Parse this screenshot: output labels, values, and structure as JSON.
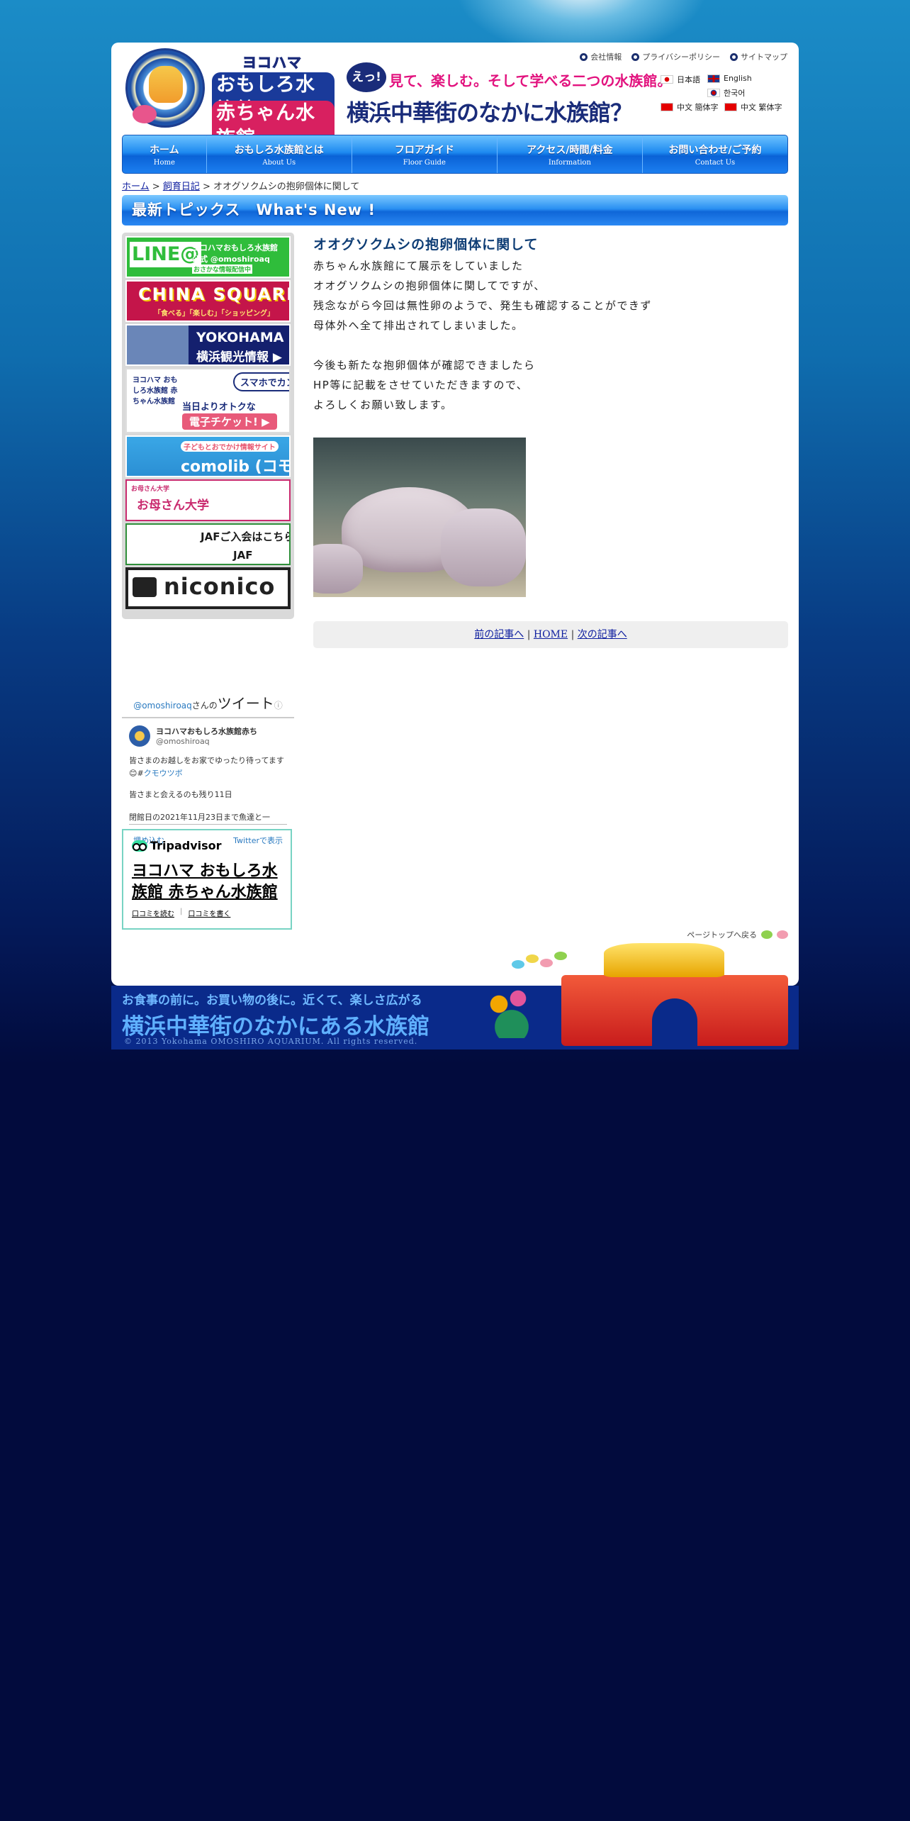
{
  "header": {
    "top_links": [
      "会社情報",
      "プライバシーポリシー",
      "サイトマップ"
    ],
    "logo": {
      "line1": "ヨコハマ",
      "line2": "おもしろ水族館",
      "line3": "赤ちゃん水族館"
    },
    "catch": {
      "bubble": "えっ!",
      "line1": "見て、楽しむ。そして学べる二つの水族館。",
      "line2": "横浜中華街のなかに水族館？"
    },
    "languages": [
      "日本語",
      "English",
      "한국어",
      "中文 簡体字",
      "中文 繁体字"
    ]
  },
  "nav": [
    {
      "ja": "ホーム",
      "en": "Home"
    },
    {
      "ja": "おもしろ水族館とは",
      "en": "About Us"
    },
    {
      "ja": "フロアガイド",
      "en": "Floor Guide"
    },
    {
      "ja": "アクセス/時間/料金",
      "en": "Information"
    },
    {
      "ja": "お問い合わせ/ご予約",
      "en": "Contact Us"
    }
  ],
  "breadcrumb": {
    "home": "ホーム",
    "sep": ">",
    "category": "飼育日記",
    "current": "オオグソクムシの抱卵個体に関して"
  },
  "topics_title": "最新トピックス　What's New !",
  "banners": {
    "line": {
      "a": "LINE@",
      "b": "ヨコハマおもしろ水族館",
      "c": "公式 @omoshiroaq",
      "d": "おさかな情報配信中"
    },
    "china": {
      "a": "CHINA SQUARE",
      "b": "「食べる」「楽しむ」「ショッピング」"
    },
    "yokohama": {
      "a": "YOKOHAMA",
      "b": "横浜観光情報 ▶"
    },
    "ticket": {
      "a": "ヨコハマ おもしろ水族館 赤ちゃん水族館",
      "b": "スマホでカンタン♪",
      "c": "当日よりオトクな",
      "d": "電子チケット! ▶"
    },
    "comolib": {
      "a": "子どもとおでかけ情報サイト",
      "b": "comolib (コモリブ)"
    },
    "okaasan": {
      "a": "お母さん大学",
      "b": "お母さん大学"
    },
    "jaf": {
      "a": "JAFご入会はこちら",
      "b": "JAF"
    },
    "niconico": {
      "a": "niconico"
    }
  },
  "twitter": {
    "head_handle": "@omoshiroaq",
    "head_suffix": "さんの",
    "head_title": "ツイート",
    "name": "ヨコハマおもしろ水族館赤ち",
    "handle": "@omoshiroaq",
    "text1": "皆さまのお越しをお家でゆったり待ってます😊#",
    "tag": "クモウツボ",
    "text2": "皆さまと会えるのも残り11日",
    "text3": "閉館日の2021年11月23日まで魚達と一",
    "embed": "埋め込む",
    "view": "Twitterで表示"
  },
  "tripadvisor": {
    "logo": "Tripadvisor",
    "name": "ヨコハマ おもしろ水族館 赤ちゃん水族館",
    "read": "口コミを読む",
    "write": "口コミを書く"
  },
  "article": {
    "title": "オオグソクムシの抱卵個体に関して",
    "lines": [
      "赤ちゃん水族館にて展示をしていました",
      "オオグソクムシの抱卵個体に関してですが、",
      "残念ながら今回は無性卵のようで、発生も確認することができず",
      "母体外へ全て排出されてしまいました。",
      "",
      "今後も新たな抱卵個体が確認できましたら",
      "HP等に記載をさせていただきますので、",
      "よろしくお願い致します。"
    ]
  },
  "pager": {
    "prev": "前の記事へ",
    "home": "HOME",
    "next": "次の記事へ",
    "sep": "|"
  },
  "pagetop": "ページトップへ戻る",
  "footer": {
    "line1": "お食事の前に。お買い物の後に。近くて、楽しさ広がる",
    "line2": "横浜中華街のなかにある水族館",
    "copyright": "© 2013 Yokohama OMOSHIRO AQUARIUM. All rights reserved."
  }
}
